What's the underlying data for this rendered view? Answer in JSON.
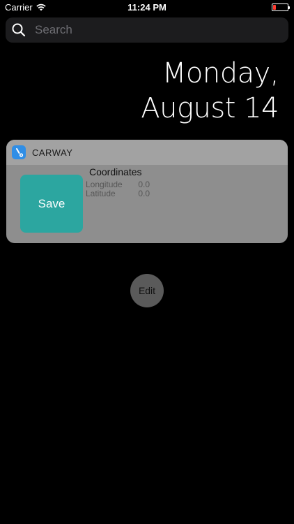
{
  "status_bar": {
    "carrier": "Carrier",
    "time": "11:24 PM",
    "battery_color": "#ff3b30"
  },
  "search": {
    "placeholder": "Search",
    "icon": "search-icon"
  },
  "date": {
    "line1": "Monday,",
    "line2": "August 14"
  },
  "widget": {
    "app_name": "CARWAY",
    "app_icon": "carway-app-icon",
    "save_label": "Save",
    "save_color": "#2ca6a0",
    "coordinates_title": "Coordinates",
    "longitude_label": "Longitude",
    "longitude_value": "0.0",
    "latitude_label": "Latitude",
    "latitude_value": "0.0"
  },
  "edit_label": "Edit"
}
